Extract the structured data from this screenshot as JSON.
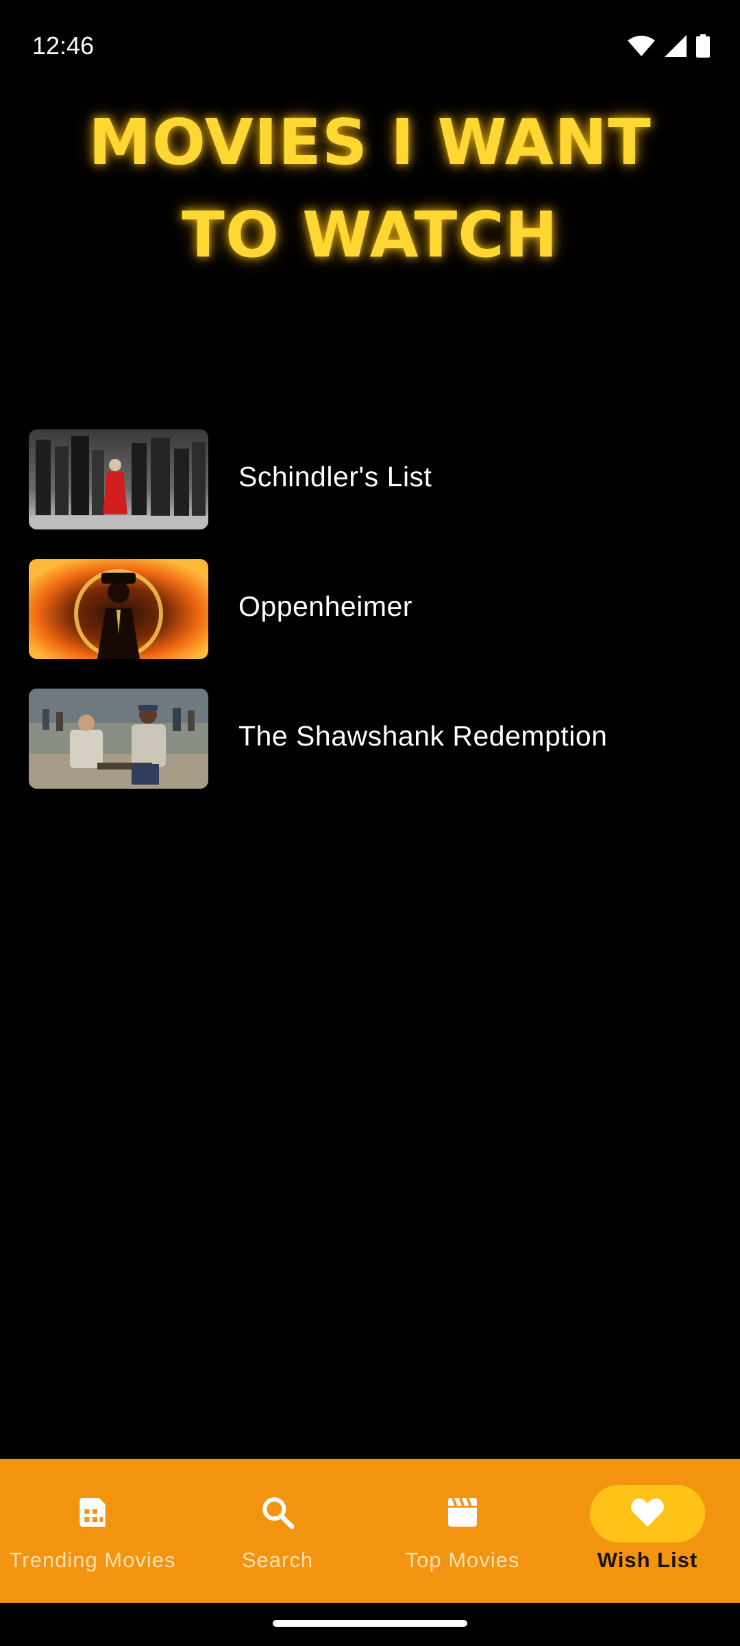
{
  "status_bar": {
    "time": "12:46",
    "icons": [
      "wifi-icon",
      "signal-icon",
      "battery-icon"
    ]
  },
  "page": {
    "title": "MOVIES I WANT TO WATCH",
    "accent_color": "#ffd733"
  },
  "wishlist": {
    "items": [
      {
        "title": "Schindler's List",
        "poster": "schindlers-list-poster"
      },
      {
        "title": "Oppenheimer",
        "poster": "oppenheimer-poster"
      },
      {
        "title": "The Shawshank Redemption",
        "poster": "shawshank-poster"
      }
    ]
  },
  "bottom_nav": {
    "background": "#f29410",
    "active_indicator": "#ffc216",
    "items": [
      {
        "label": "Trending Movies",
        "icon": "film-icon",
        "active": false
      },
      {
        "label": "Search",
        "icon": "search-icon",
        "active": false
      },
      {
        "label": "Top Movies",
        "icon": "clapperboard-icon",
        "active": false
      },
      {
        "label": "Wish List",
        "icon": "heart-icon",
        "active": true
      }
    ]
  }
}
